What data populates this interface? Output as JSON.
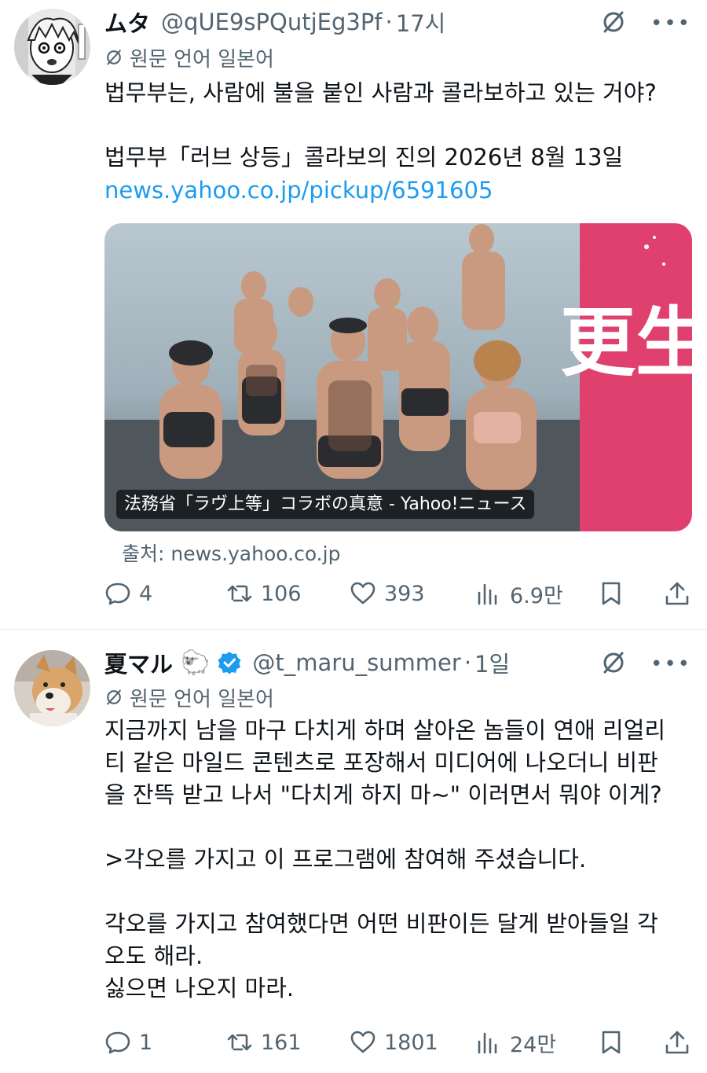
{
  "tweets": [
    {
      "display_name": "ムタ",
      "handle": "@qUE9sPQutjEg3Pf",
      "separator": "·",
      "time": "17시",
      "translated_note": "원문 언어 일본어",
      "text": "법무부는, 사람에 불을 붙인 사람과 콜라보하고 있는 거야?\n\n법무부「러브 상등」콜라보의 진의 2026년 8월 13일",
      "link": "news.yahoo.co.jp/pickup/6591605",
      "card": {
        "caption": "法務省「ラヴ上等」コラボの真意 - Yahoo!ニュース",
        "banner_text": "更生"
      },
      "source": "출처: news.yahoo.co.jp",
      "actions": {
        "replies": "4",
        "retweets": "106",
        "likes": "393",
        "views": "6.9만"
      }
    },
    {
      "display_name": "夏マル",
      "emoji": "🐑",
      "handle": "@t_maru_summer",
      "separator": "·",
      "time": "1일",
      "translated_note": "원문 언어 일본어",
      "text": "지금까지 남을 마구 다치게 하며 살아온 놈들이 연애 리얼리\n티 같은 마일드 콘텐츠로 포장해서 미디어에 나오더니 비판\n을 잔뜩 받고 나서 \"다치게 하지 마~\" 이러면서 뭐야 이게?\n\n>각오를 가지고 이 프로그램에 참여해 주셨습니다.\n\n각오를 가지고 참여했다면 어떤 비판이든 달게 받아들일 각\n오도 해라.\n싫으면 나오지 마라.",
      "actions": {
        "replies": "1",
        "retweets": "161",
        "likes": "1801",
        "views": "24만"
      }
    }
  ],
  "colors": {
    "text": "#0f1419",
    "secondary": "#536471",
    "link": "#1d9bf0",
    "verified": "#1d9bf0",
    "banner_pink": "#e0406e"
  },
  "icons": [
    "translate-icon",
    "more-icon",
    "reply-icon",
    "retweet-icon",
    "like-icon",
    "views-icon",
    "bookmark-icon",
    "share-icon",
    "verified-icon"
  ]
}
